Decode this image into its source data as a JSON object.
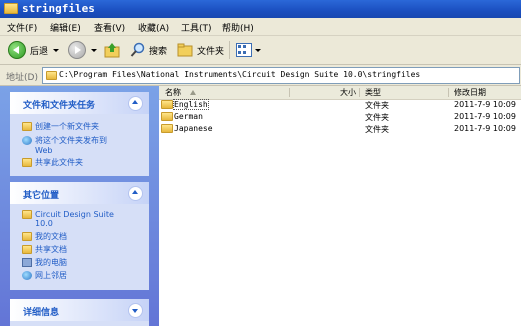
{
  "window": {
    "title": "stringfiles"
  },
  "menu": [
    "文件(F)",
    "编辑(E)",
    "查看(V)",
    "收藏(A)",
    "工具(T)",
    "帮助(H)"
  ],
  "toolbar": {
    "back": "后退",
    "search": "搜索",
    "folders": "文件夹"
  },
  "address": {
    "label": "地址(D)",
    "path": "C:\\Program Files\\National Instruments\\Circuit Design Suite 10.0\\stringfiles"
  },
  "tasks": {
    "title": "文件和文件夹任务",
    "items": [
      "创建一个新文件夹",
      "将这个文件夹发布到",
      "Web",
      "共享此文件夹"
    ]
  },
  "places": {
    "title": "其它位置",
    "items": [
      "Circuit Design Suite",
      "10.0",
      "我的文档",
      "共享文档",
      "我的电脑",
      "网上邻居"
    ]
  },
  "details": {
    "title": "详细信息"
  },
  "list": {
    "columns": {
      "name": "名称",
      "size": "大小",
      "type": "类型",
      "modified": "修改日期"
    },
    "rows": [
      {
        "name": "English",
        "size": "",
        "type": "文件夹",
        "modified": "2011-7-9 10:09"
      },
      {
        "name": "German",
        "size": "",
        "type": "文件夹",
        "modified": "2011-7-9 10:09"
      },
      {
        "name": "Japanese",
        "size": "",
        "type": "文件夹",
        "modified": "2011-7-9 10:09"
      }
    ]
  }
}
